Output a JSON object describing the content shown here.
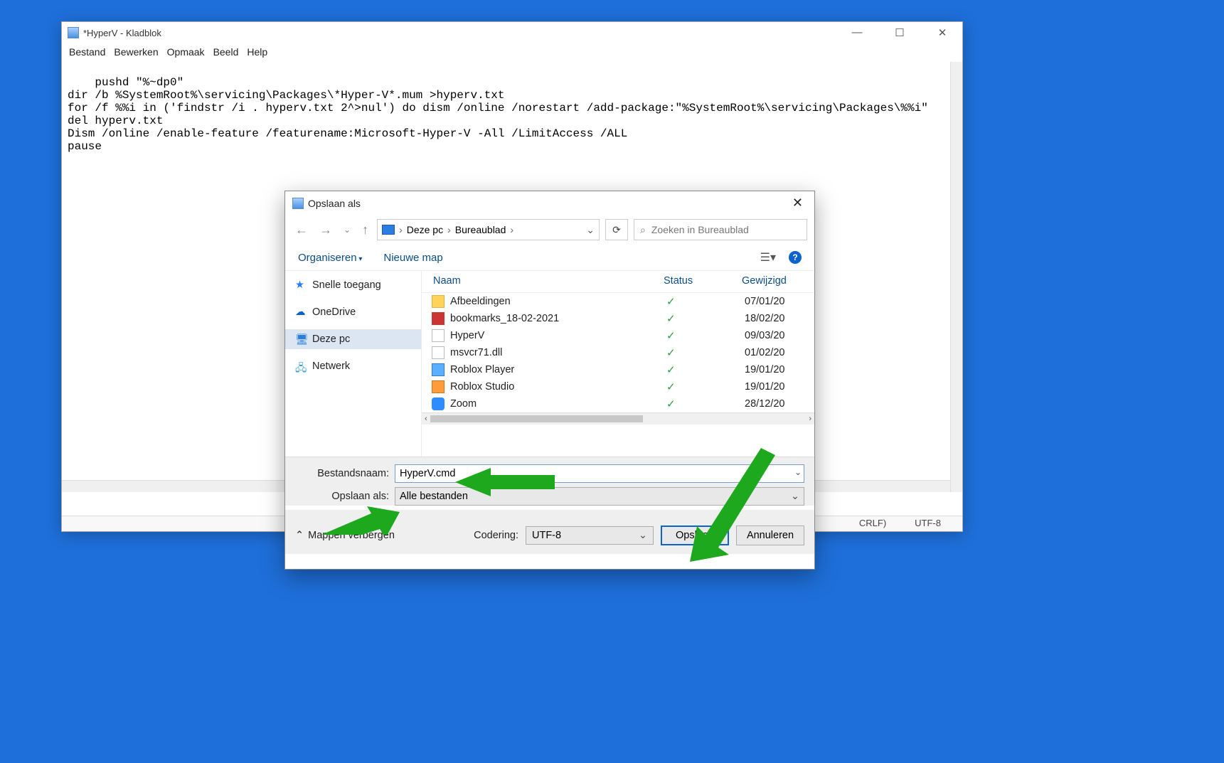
{
  "notepad": {
    "title": "*HyperV - Kladblok",
    "menu": [
      "Bestand",
      "Bewerken",
      "Opmaak",
      "Beeld",
      "Help"
    ],
    "content": "pushd \"%~dp0\"\ndir /b %SystemRoot%\\servicing\\Packages\\*Hyper-V*.mum >hyperv.txt\nfor /f %%i in ('findstr /i . hyperv.txt 2^>nul') do dism /online /norestart /add-package:\"%SystemRoot%\\servicing\\Packages\\%%i\"\ndel hyperv.txt\nDism /online /enable-feature /featurename:Microsoft-Hyper-V -All /LimitAccess /ALL\npause",
    "status": {
      "crlf": "CRLF)",
      "encoding": "UTF-8"
    }
  },
  "savedlg": {
    "title": "Opslaan als",
    "breadcrumb": {
      "pc": "Deze pc",
      "folder": "Bureaublad"
    },
    "search_placeholder": "Zoeken in Bureaublad",
    "toolbar": {
      "organise": "Organiseren",
      "newfolder": "Nieuwe map"
    },
    "headers": {
      "name": "Naam",
      "status": "Status",
      "date": "Gewijzigd"
    },
    "tree": {
      "quick": "Snelle toegang",
      "onedrive": "OneDrive",
      "thispc": "Deze pc",
      "network": "Netwerk"
    },
    "files": [
      {
        "icon": "folder",
        "name": "Afbeeldingen",
        "date": "07/01/20"
      },
      {
        "icon": "html",
        "name": "bookmarks_18-02-2021",
        "date": "18/02/20"
      },
      {
        "icon": "file",
        "name": "HyperV",
        "date": "09/03/20"
      },
      {
        "icon": "file",
        "name": "msvcr71.dll",
        "date": "01/02/20"
      },
      {
        "icon": "app",
        "name": "Roblox Player",
        "date": "19/01/20"
      },
      {
        "icon": "app2",
        "name": "Roblox Studio",
        "date": "19/01/20"
      },
      {
        "icon": "zoom",
        "name": "Zoom",
        "date": "28/12/20"
      }
    ],
    "fields": {
      "filename_label": "Bestandsnaam:",
      "filename_value": "HyperV.cmd",
      "saveas_label": "Opslaan als:",
      "saveas_value": "Alle bestanden",
      "encoding_label": "Codering:",
      "encoding_value": "UTF-8",
      "hide_folders": "Mappen verbergen",
      "save": "Opslaan",
      "cancel": "Annuleren"
    }
  }
}
